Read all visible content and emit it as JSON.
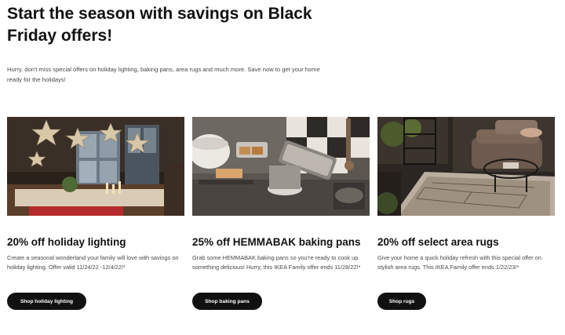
{
  "hero": {
    "headline": "Start the season with savings on Black Friday offers!",
    "intro": "Hurry, don't miss special offers on holiday lighting, baking pans, area rugs and much more. Save now to get your home ready for the holidays!"
  },
  "offers": [
    {
      "title": "20% off holiday lighting",
      "description": "Create a seasonal wonderland your family will love with savings on holiday lighting. Offer valid 11/24/22 -12/4/22!*",
      "button_label": "Shop holiday lighting",
      "image_subject": "living room with paper star lamps"
    },
    {
      "title": "25% off HEMMABAK baking pans",
      "description": "Grab some HEMMABAK baking pans so you're ready to cook up something delicious! Hurry, this IKEA Family offer ends 11/28/22!*",
      "button_label": "Shop baking pans",
      "image_subject": "kitchen counter with baking pans and bread"
    },
    {
      "title": "20% off select area rugs",
      "description": "Give your home a quick holiday refresh with this special offer on stylish area rugs. This IKEA Family offer ends 1/22/23!*",
      "button_label": "Shop rugs",
      "image_subject": "living room with sofa and patterned area rug"
    }
  ],
  "colors": {
    "text": "#111111",
    "body_text": "#484848",
    "button_bg": "#111111",
    "button_text": "#ffffff"
  }
}
